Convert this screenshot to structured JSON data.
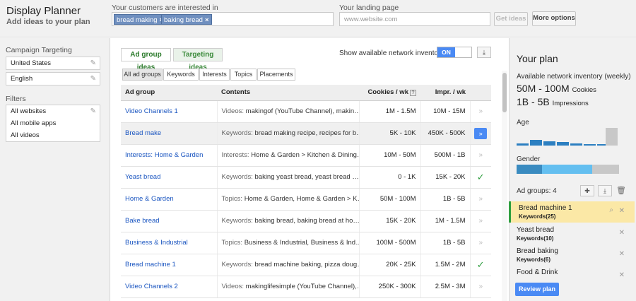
{
  "header": {
    "title": "Display Planner",
    "subtitle": "Add ideas to your plan",
    "customers_label": "Your customers are interested in",
    "chips": [
      "bread making",
      "baking bread"
    ],
    "landing_label": "Your landing page",
    "landing_placeholder": "www.website.com",
    "get_ideas_label": "Get ideas",
    "more_options_label": "More options"
  },
  "left": {
    "campaign_targeting_label": "Campaign Targeting",
    "targeting_rows": [
      "United States",
      "English"
    ],
    "filters_label": "Filters",
    "filter_rows": [
      "All websites",
      "All mobile apps",
      "All videos"
    ]
  },
  "main": {
    "tabs": [
      "Ad group ideas",
      "Targeting ideas"
    ],
    "inventory_label": "Show available network inventory:",
    "toggle_on": "ON",
    "subtabs": [
      "All ad groups",
      "Keywords",
      "Interests",
      "Topics",
      "Placements"
    ],
    "columns": [
      "Ad group",
      "Contents",
      "Cookies / wk",
      "Impr. / wk"
    ],
    "help_glyph": "?",
    "rows": [
      {
        "name": "Video Channels 1",
        "ctype": "Videos:",
        "contents": " makingof (YouTube Channel), makin…",
        "cookies": "1M - 1.5M",
        "impr": "10M - 15M",
        "action": "chevron"
      },
      {
        "name": "Bread make",
        "ctype": "Keywords:",
        "contents": " bread making recipe, recipes for b…",
        "cookies": "5K - 10K",
        "impr": "450K - 500K",
        "action": "arrow"
      },
      {
        "name": "Interests: Home & Garden",
        "ctype": "Interests:",
        "contents": " Home & Garden > Kitchen & Dining…",
        "cookies": "10M - 50M",
        "impr": "500M - 1B",
        "action": "chevron"
      },
      {
        "name": "Yeast bread",
        "ctype": "Keywords:",
        "contents": " baking yeast bread, yeast bread …",
        "cookies": "0 - 1K",
        "impr": "15K - 20K",
        "action": "check"
      },
      {
        "name": "Home & Garden",
        "ctype": "Topics:",
        "contents": " Home & Garden, Home & Garden > K…",
        "cookies": "50M - 100M",
        "impr": "1B - 5B",
        "action": "chevron"
      },
      {
        "name": "Bake bread",
        "ctype": "Keywords:",
        "contents": " baking bread, baking bread at ho…",
        "cookies": "15K - 20K",
        "impr": "1M - 1.5M",
        "action": "chevron"
      },
      {
        "name": "Business & Industrial",
        "ctype": "Topics:",
        "contents": " Business & Industrial, Business & Ind…",
        "cookies": "100M - 500M",
        "impr": "1B - 5B",
        "action": "chevron"
      },
      {
        "name": "Bread machine 1",
        "ctype": "Keywords:",
        "contents": " bread machine baking, pizza doug…",
        "cookies": "20K - 25K",
        "impr": "1.5M - 2M",
        "action": "check"
      },
      {
        "name": "Video Channels 2",
        "ctype": "Videos:",
        "contents": " makinglifesimple (YouTube Channel),…",
        "cookies": "250K - 300K",
        "impr": "2.5M - 3M",
        "action": "chevron"
      }
    ]
  },
  "plan": {
    "title": "Your plan",
    "inventory_label": "Available network inventory (weekly)",
    "cookies_value": "50M - 100M",
    "cookies_unit": "Cookies",
    "impressions_value": "1B - 5B",
    "impressions_unit": "Impressions",
    "age_label": "Age",
    "age_bars": [
      0.1,
      0.28,
      0.22,
      0.18,
      0.1,
      0.05,
      0.07
    ],
    "gender_label": "Gender",
    "gender_shares": [
      0.25,
      0.49,
      0.26
    ],
    "ad_groups_label": "Ad groups: 4",
    "items": [
      {
        "name": "Bread machine 1",
        "sub": "Keywords(25)",
        "selected": true
      },
      {
        "name": "Yeast bread",
        "sub": "Keywords(10)",
        "selected": false
      },
      {
        "name": "Bread baking",
        "sub": "Keywords(6)",
        "selected": false
      },
      {
        "name": "Food & Drink",
        "sub": "",
        "selected": false
      }
    ],
    "review_label": "Review plan"
  },
  "colors": {
    "accent_blue": "#4a8af4",
    "link_blue": "#1a55c0",
    "tab_green": "#2a7a2a",
    "check_green": "#2e9e3e",
    "selected_yellow": "#fbe8a6",
    "age_bar_blue": "#2c7fc1",
    "gender_dark": "#3a8bc0",
    "gender_light": "#64bff0",
    "gender_gray": "#c8c8c8"
  }
}
